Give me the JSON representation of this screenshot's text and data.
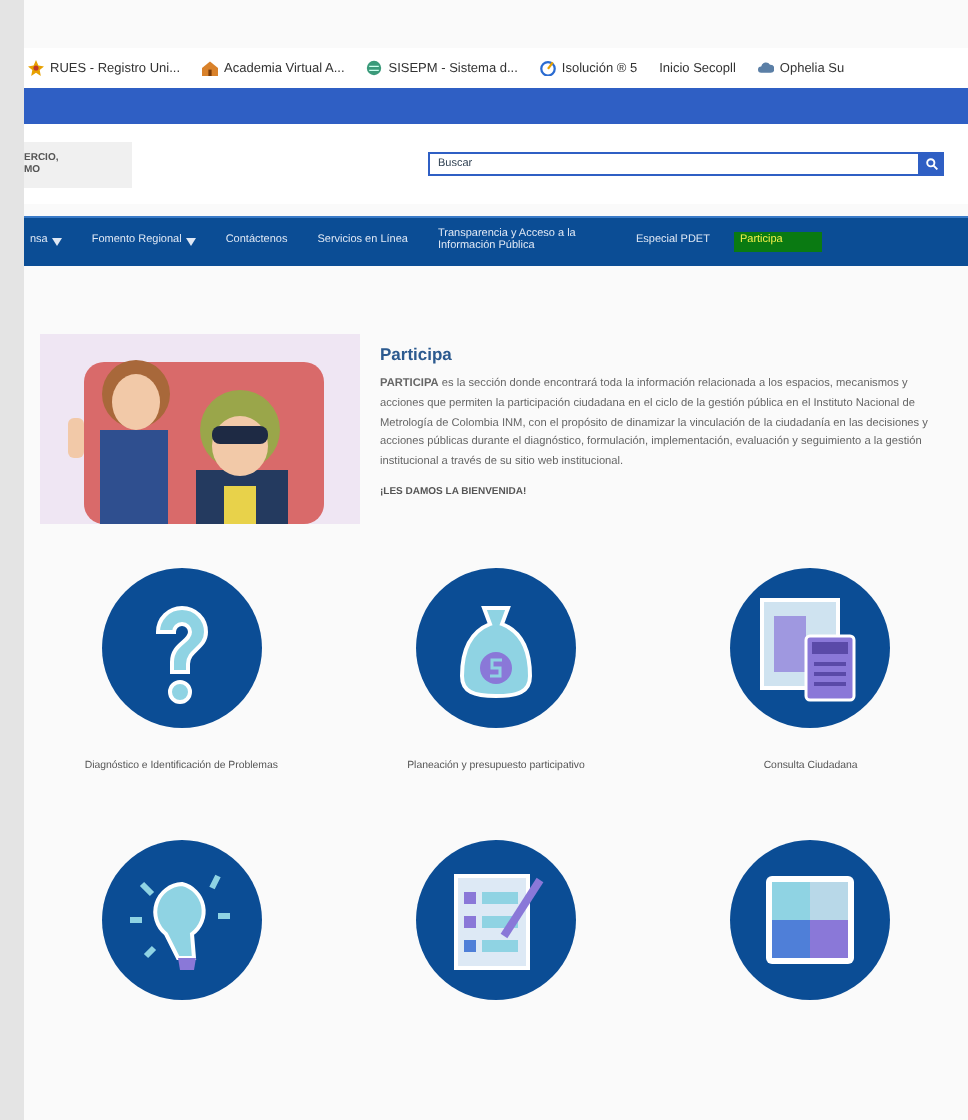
{
  "bookmarks": [
    {
      "kind": "flag",
      "label": "RUES - Registro Uni..."
    },
    {
      "kind": "hat",
      "label": "Academia Virtual A..."
    },
    {
      "kind": "globe",
      "label": "SISEPM - Sistema d..."
    },
    {
      "kind": "gauge",
      "label": "Isolución ® 5"
    },
    {
      "kind": "none",
      "label": "Inicio Secopll"
    },
    {
      "kind": "cloud",
      "label": "Ophelia Su"
    }
  ],
  "header": {
    "logo_lines": [
      "ERCIO,",
      "MO"
    ],
    "search": {
      "placeholder": "Buscar"
    }
  },
  "nav": [
    {
      "label": "nsa",
      "dropdown": true,
      "selected": false
    },
    {
      "label": "Fomento Regional",
      "dropdown": true,
      "selected": false
    },
    {
      "label": "Contáctenos",
      "dropdown": false,
      "selected": false
    },
    {
      "label": "Servicios en Línea",
      "dropdown": false,
      "selected": false
    },
    {
      "label": "Transparencia y Acceso a la Información Pública",
      "dropdown": false,
      "selected": false
    },
    {
      "label": "Especial PDET",
      "dropdown": false,
      "selected": false
    },
    {
      "label": "Participa",
      "dropdown": false,
      "selected": true
    }
  ],
  "intro": {
    "title": "Participa",
    "body": "**PARTICIPA** es la sección donde encontrará toda la información relacionada a los espacios, mecanismos y acciones que permiten la participación ciudadana en el ciclo de la gestión pública en el Instituto Nacional de Metrología de Colombia INM, con el propósito de dinamizar la vinculación de la ciudadanía en las decisiones y acciones públicas durante el diagnóstico, formulación, implementación, evaluación y seguimiento a la gestión institucional a través de su sitio web institucional.",
    "welcome": "¡LES DAMOS LA BIENVENIDA!"
  },
  "cards": [
    {
      "kind": "question",
      "label": "Diagnóstico e Identificación de Problemas"
    },
    {
      "kind": "money",
      "label": "Planeación y presupuesto participativo"
    },
    {
      "kind": "calculator",
      "label": "Consulta Ciudadana"
    },
    {
      "kind": "bulb"
    },
    {
      "kind": "checklist"
    },
    {
      "kind": "puzzle"
    }
  ]
}
